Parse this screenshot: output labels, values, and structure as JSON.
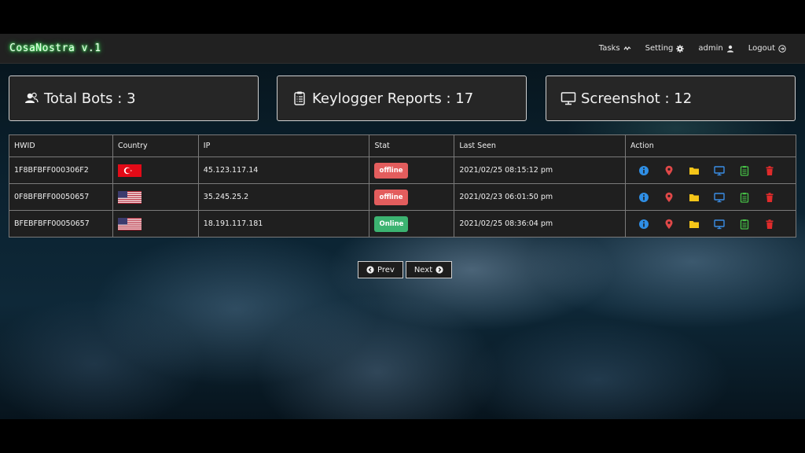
{
  "brand": "CosaNostra v.1",
  "nav": {
    "tasks": "Tasks",
    "setting": "Setting",
    "admin": "admin",
    "logout": "Logout"
  },
  "stats": {
    "total_bots": "Total Bots : 3",
    "keylogger": "Keylogger Reports : 17",
    "screenshot": "Screenshot : 12"
  },
  "table": {
    "headers": {
      "hwid": "HWID",
      "country": "Country",
      "ip": "IP",
      "stat": "Stat",
      "last_seen": "Last Seen",
      "action": "Action"
    },
    "rows": [
      {
        "hwid": "1F8BFBFF000306F2",
        "country": "turkey",
        "ip": "45.123.117.14",
        "stat": "offline",
        "last_seen": "2021/02/25 08:15:12 pm"
      },
      {
        "hwid": "0F8BFBFF00050657",
        "country": "usa",
        "ip": "35.245.25.2",
        "stat": "offline",
        "last_seen": "2021/02/23 06:01:50 pm"
      },
      {
        "hwid": "BFEBFBFF00050657",
        "country": "usa",
        "ip": "18.191.117.181",
        "stat": "Online",
        "last_seen": "2021/02/25 08:36:04 pm"
      }
    ]
  },
  "pager": {
    "prev": "Prev",
    "next": "Next"
  },
  "icons": {
    "info": "info-icon",
    "location": "map-marker-icon",
    "folder": "folder-icon",
    "monitor": "monitor-icon",
    "clipboard": "clipboard-icon",
    "delete": "trash-icon"
  },
  "colors": {
    "brand_glow": "#39ff5a",
    "offline": "#e35d5d",
    "online": "#3cb371",
    "info": "#2f8fe6",
    "location": "#e04848",
    "folder": "#f5c518",
    "monitor": "#3a8ee6",
    "clipboard": "#47c247",
    "delete": "#e02b2b"
  }
}
